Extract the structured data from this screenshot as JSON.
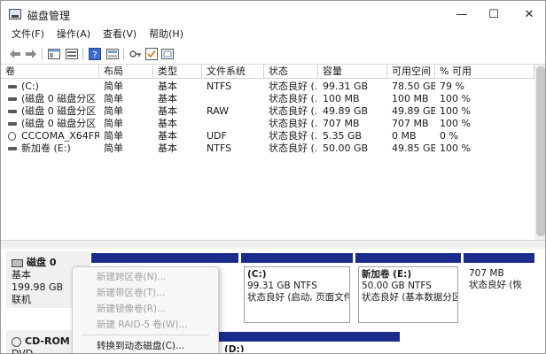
{
  "window": {
    "title": "磁盘管理",
    "min_glyph": "—",
    "max_glyph": "☐",
    "close_glyph": "✕"
  },
  "menubar": [
    "文件(F)",
    "操作(A)",
    "查看(V)",
    "帮助(H)"
  ],
  "toolbar": {
    "icons": [
      "back-arrow-icon",
      "forward-arrow-icon",
      "console-tree-icon",
      "help-icon",
      "properties-icon",
      "key-icon",
      "check-icon",
      "settings-icon"
    ]
  },
  "volumes": {
    "columns": [
      "卷",
      "布局",
      "类型",
      "文件系统",
      "状态",
      "容量",
      "可用空间",
      "% 可用"
    ],
    "rows": [
      [
        "(C:)",
        "简单",
        "基本",
        "NTFS",
        "状态良好 (...",
        "99.31 GB",
        "78.50 GB",
        "79 %"
      ],
      [
        "(磁盘 0 磁盘分区 1)",
        "简单",
        "基本",
        "",
        "状态良好 (...",
        "100 MB",
        "100 MB",
        "100 %"
      ],
      [
        "(磁盘 0 磁盘分区 3)",
        "简单",
        "基本",
        "RAW",
        "状态良好 (...",
        "49.89 GB",
        "49.89 GB",
        "100 %"
      ],
      [
        "(磁盘 0 磁盘分区 6)",
        "简单",
        "基本",
        "",
        "状态良好 (...",
        "707 MB",
        "707 MB",
        "100 %"
      ],
      [
        "CCCOMA_X64FR...",
        "简单",
        "基本",
        "UDF",
        "状态良好 (...",
        "5.35 GB",
        "0 MB",
        "0 %"
      ],
      [
        "新加卷 (E:)",
        "简单",
        "基本",
        "NTFS",
        "状态良好 (...",
        "50.00 GB",
        "49.85 GB",
        "100 %"
      ]
    ]
  },
  "disks": [
    {
      "name": "磁盘 0",
      "type": "基本",
      "size": "199.98 GB",
      "status": "联机",
      "partitions": [
        {
          "name": "",
          "size": "",
          "status": ""
        },
        {
          "name": "(C:)",
          "size": "99.31 GB NTFS",
          "status": "状态良好 (启动, 页面文件,"
        },
        {
          "name": "新加卷  (E:)",
          "size": "50.00 GB NTFS",
          "status": "状态良好 (基本数据分区)"
        },
        {
          "name": "",
          "size": "707 MB",
          "status": "状态良好 (恢"
        }
      ]
    },
    {
      "name": "CD-ROM",
      "type": "DVD",
      "partition_name": "(D:)"
    }
  ],
  "context_menu": [
    {
      "label": "新建跨区卷(N)...",
      "enabled": false
    },
    {
      "label": "新建带区卷(T)...",
      "enabled": false
    },
    {
      "label": "新建镜像卷(R)...",
      "enabled": false
    },
    {
      "label": "新建 RAID-5 卷(W)...",
      "enabled": false
    },
    {
      "label": "转换到动态磁盘(C)...",
      "enabled": true
    }
  ],
  "colors": {
    "partition_bar": "#1a2d8c",
    "disabled_text": "#a0a0a0"
  }
}
